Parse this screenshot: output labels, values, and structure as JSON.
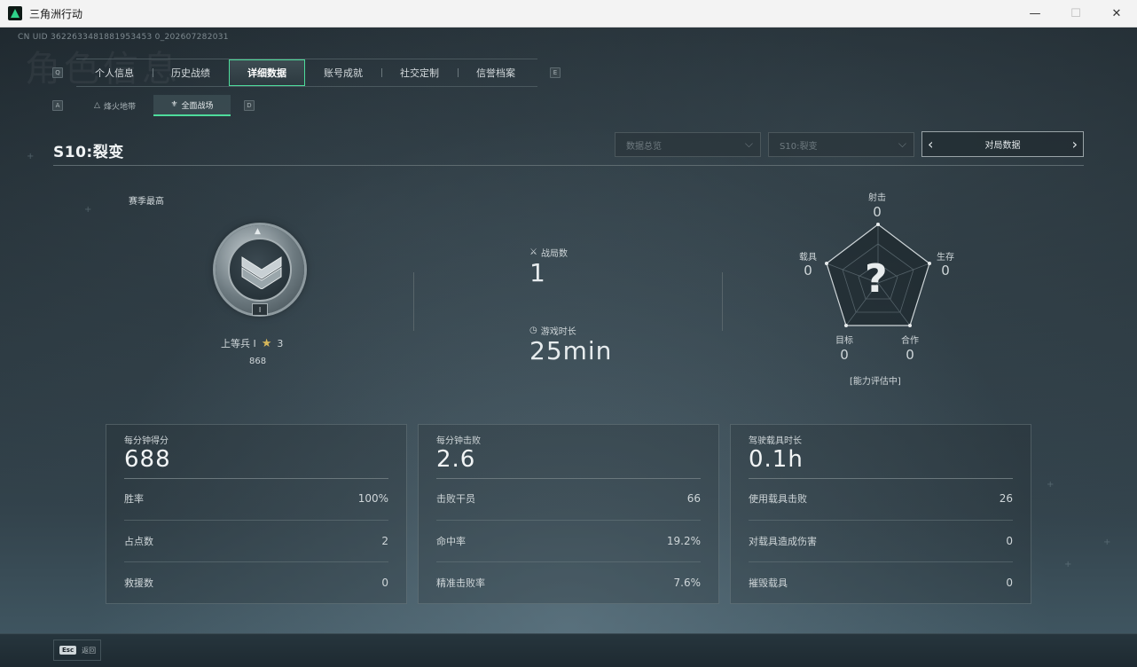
{
  "window": {
    "title": "三角洲行动",
    "minimize": "—",
    "maximize": "☐",
    "close": "✕"
  },
  "uid": "CN UID 3622633481881953453 0_202607282031",
  "ghost_title": "角色信息",
  "key_hints": {
    "prev_tab": "Q",
    "next_tab": "E",
    "prev_sub": "A",
    "next_sub": "D"
  },
  "main_tabs": [
    {
      "label": "个人信息"
    },
    {
      "label": "历史战绩"
    },
    {
      "label": "详细数据"
    },
    {
      "label": "账号成就"
    },
    {
      "label": "社交定制"
    },
    {
      "label": "信誉档案"
    }
  ],
  "sub_tabs": [
    {
      "label": "烽火地带",
      "icon": "△"
    },
    {
      "label": "全面战场",
      "icon": "⚜"
    }
  ],
  "season": {
    "title": "S10:裂变"
  },
  "filters": {
    "data_type": "数据总览",
    "season": "S10:裂变",
    "pager_label": "对局数据",
    "chev": "⌵",
    "left_arrow": "‹",
    "right_arrow": "›"
  },
  "rank": {
    "season_best_label": "赛季最高",
    "roman": "I",
    "name": "上等兵 I",
    "star": "★",
    "stars": "3",
    "points": "868"
  },
  "middle": {
    "matches_label": "战局数",
    "matches_value": "1",
    "playtime_label": "游戏时长",
    "playtime_value": "25min"
  },
  "radar": {
    "shooting_label": "射击",
    "shooting_value": "0",
    "survival_label": "生存",
    "survival_value": "0",
    "coop_label": "合作",
    "coop_value": "0",
    "objective_label": "目标",
    "objective_value": "0",
    "vehicle_label": "载具",
    "vehicle_value": "0",
    "placeholder": "?",
    "note": "[能力评估中]"
  },
  "cards": [
    {
      "head_label": "每分钟得分",
      "head_value": "688",
      "rows": [
        {
          "label": "胜率",
          "value": "100%"
        },
        {
          "label": "占点数",
          "value": "2"
        },
        {
          "label": "救援数",
          "value": "0"
        }
      ]
    },
    {
      "head_label": "每分钟击败",
      "head_value": "2.6",
      "rows": [
        {
          "label": "击败干员",
          "value": "66"
        },
        {
          "label": "命中率",
          "value": "19.2%"
        },
        {
          "label": "精准击败率",
          "value": "7.6%"
        }
      ]
    },
    {
      "head_label": "驾驶载具时长",
      "head_value": "0.1h",
      "rows": [
        {
          "label": "使用载具击败",
          "value": "26"
        },
        {
          "label": "对载具造成伤害",
          "value": "0"
        },
        {
          "label": "摧毁载具",
          "value": "0"
        }
      ]
    }
  ],
  "bottom": {
    "esc_key": "Esc",
    "esc_label": "返回"
  }
}
